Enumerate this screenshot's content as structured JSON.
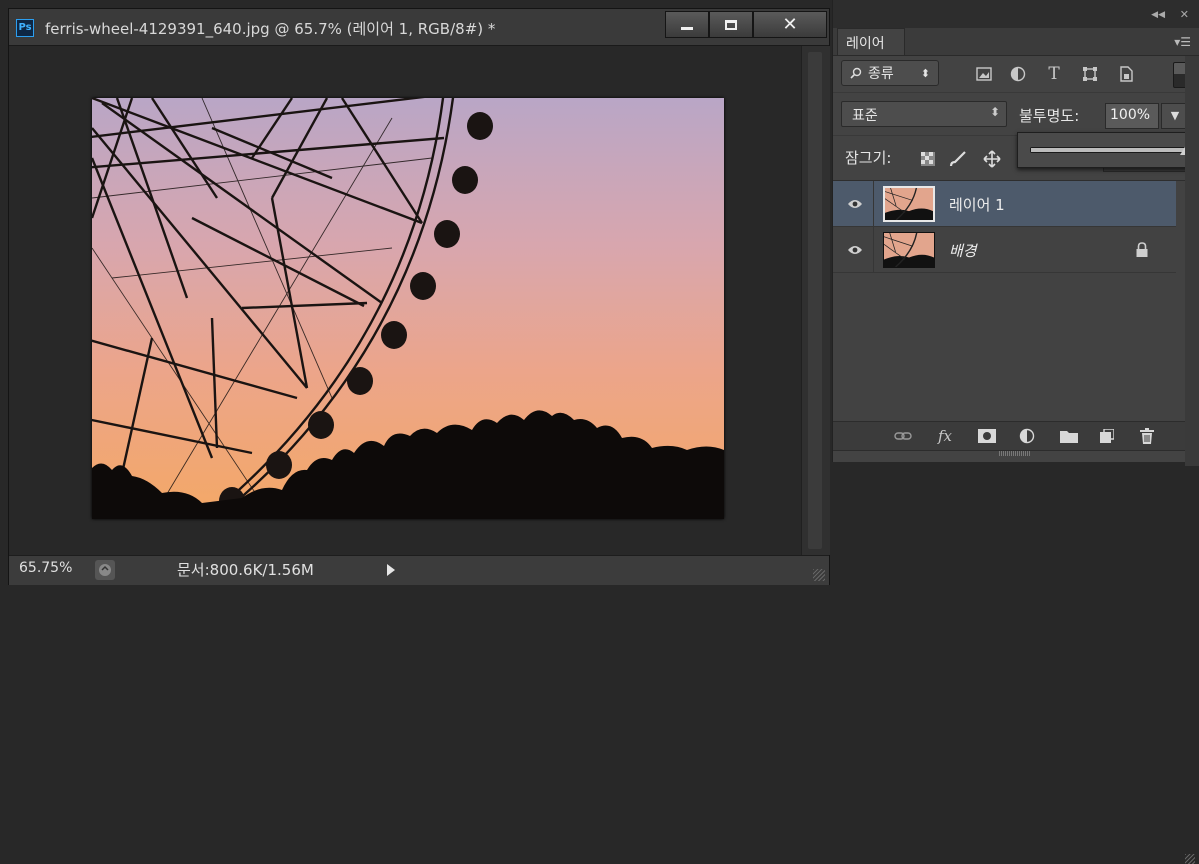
{
  "document": {
    "title": "ferris-wheel-4129391_640.jpg @ 65.7% (레이어 1, RGB/8#) *",
    "app_badge": "Ps",
    "window_controls": {
      "minimize": "minimize-icon",
      "maximize": "maximize-icon",
      "close": "close-icon",
      "close_glyph": "✕"
    },
    "status": {
      "zoom": "65.75%",
      "doc_info": "문서:800.6K/1.56M"
    }
  },
  "layers_panel": {
    "tab_label": "레이어",
    "filter": {
      "kind_label": "종류",
      "caret": "⬍"
    },
    "filter_icons": [
      "image-filter-icon",
      "adjustment-filter-icon",
      "type-filter-icon",
      "shape-filter-icon",
      "smart-object-filter-icon"
    ],
    "blend_mode": "표준",
    "opacity_label": "불투명도:",
    "opacity_value": "100%",
    "opacity_slider_level": 1.0,
    "lock_label": "잠그기:",
    "lock_icons": [
      "lock-transparent-icon",
      "lock-image-icon",
      "lock-position-icon"
    ],
    "layers": [
      {
        "name": "레이어 1",
        "selected": true,
        "visible": true,
        "locked": false
      },
      {
        "name": "배경",
        "selected": false,
        "visible": true,
        "locked": true
      }
    ],
    "bottom_icons": [
      "link-icon",
      "fx-icon",
      "mask-icon",
      "adjustment-icon",
      "group-folder-icon",
      "new-layer-icon",
      "trash-icon"
    ],
    "fx_label": "fx"
  },
  "colors": {
    "selected_row": "#4d5a6b",
    "sky_top": "#b9a6c6",
    "sky_mid": "#eca58a",
    "sky_bottom": "#f4a866"
  }
}
